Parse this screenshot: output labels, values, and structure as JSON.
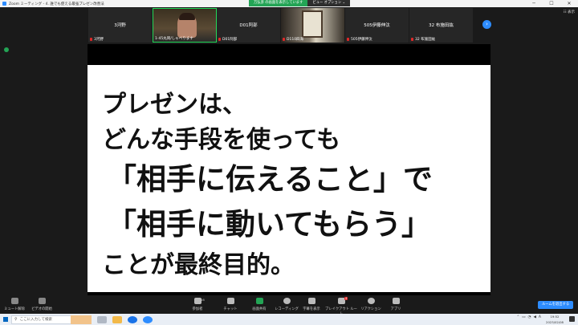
{
  "window": {
    "title": "Zoom ミーティング - 4. 誰でも使える最強プレゼン改善法",
    "controls": [
      "─",
      "☐",
      "✕"
    ]
  },
  "share_banner": {
    "status": "万弘彦 の画面を表示しています",
    "view_options": "ビュー オプション ⌄"
  },
  "view_button": "☷ 表示",
  "participants": [
    {
      "center_name": "3河野",
      "bottom_name": "3河野",
      "video": false
    },
    {
      "center_name": "",
      "bottom_name": "1-45丸岡/しゃべります",
      "video": true
    },
    {
      "center_name": "D01阿部",
      "bottom_name": "D01阿部",
      "video": false
    },
    {
      "center_name": "",
      "bottom_name": "D110四海",
      "video": true
    },
    {
      "center_name": "505伊藤伸汰",
      "bottom_name": "505伊藤伸汰",
      "video": false
    },
    {
      "center_name": "32 布施田紘",
      "bottom_name": "32 布施田紘",
      "video": false
    }
  ],
  "slide": {
    "lines": [
      "プレゼンは、",
      "どんな手段を使っても",
      "「相手に伝えること」で",
      "「相手に動いてもらう」",
      "ことが最終目的。"
    ]
  },
  "toolbar": {
    "mute": "ミュート解除",
    "video": "ビデオの開始",
    "participants": "参加者",
    "participants_count": "16",
    "chat": "チャット",
    "share": "画面共有",
    "record": "レコーディング",
    "captions": "字幕を表示",
    "breakout": "ブレイクアウト ルーム",
    "breakout_badge": "4",
    "reactions": "リアクション",
    "apps": "アプリ",
    "leave": "ルームを退出する"
  },
  "taskbar": {
    "search_placeholder": "ここに入力して検索",
    "tray_lang": "A",
    "time": "19:52",
    "date": "2023/02/08"
  }
}
